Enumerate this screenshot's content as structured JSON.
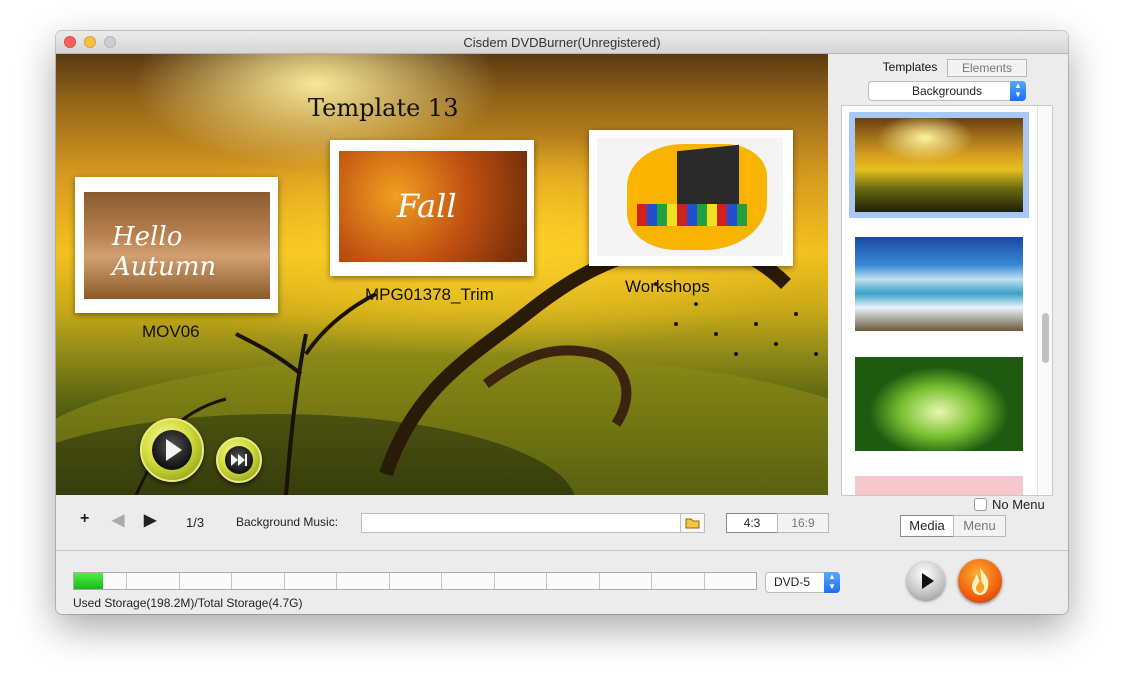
{
  "window": {
    "title": "Cisdem DVDBurner(Unregistered)"
  },
  "preview": {
    "template_title": "Template 13",
    "thumbnails": [
      {
        "label": "MOV06",
        "overlay_text": "Hello Autumn"
      },
      {
        "label": "MPG01378_Trim",
        "overlay_text": "Fall"
      },
      {
        "label": "Workshops",
        "overlay_text": ""
      }
    ],
    "icons": {
      "play": "play-icon",
      "next": "skip-forward-icon"
    }
  },
  "controls": {
    "add_icon": "plus-icon",
    "prev_icon": "arrow-left-icon",
    "next_icon": "arrow-right-icon",
    "page_indicator": "1/3",
    "bgm_label": "Background Music:",
    "bgm_value": "",
    "folder_icon": "folder-icon",
    "aspect_4_3": "4:3",
    "aspect_16_9": "16:9"
  },
  "sidebar": {
    "tabs": [
      "Templates",
      "Elements"
    ],
    "category": "Backgrounds",
    "items": [
      "autumn-sunset-background",
      "ocean-waterfall-background",
      "green-leaves-background",
      "pink-background"
    ],
    "no_menu_label": "No Menu",
    "no_menu_checked": false,
    "view_tabs": [
      "Media",
      "Menu"
    ]
  },
  "footer": {
    "storage_fraction": 0.042,
    "storage_text": "Used Storage(198.2M)/Total Storage(4.7G)",
    "disc_type": "DVD-5",
    "play_icon": "play-icon",
    "burn_icon": "flame-icon"
  },
  "colors": {
    "accent_blue": "#1b6ff0",
    "storage_green": "#2ad12a",
    "burn_orange": "#f06010",
    "selection_blue": "#a8c8f4"
  }
}
